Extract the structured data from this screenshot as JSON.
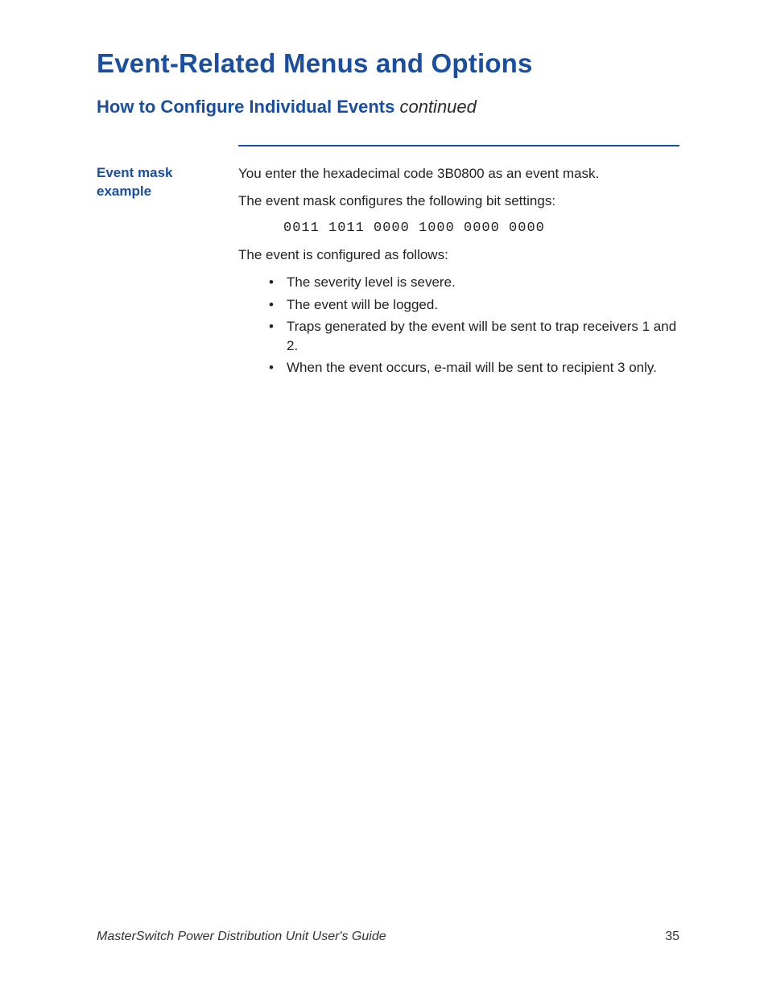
{
  "chapter_title": "Event-Related Menus and Options",
  "section_title": "How to Configure Individual Events",
  "section_suffix": " continued",
  "margin_label_line1": "Event mask",
  "margin_label_line2": "example",
  "body": {
    "p1": "You enter the hexadecimal code 3B0800 as an event mask.",
    "p2": "The event mask configures the following bit settings:",
    "bits": "0011 1011 0000 1000 0000 0000",
    "p3": "The event is configured as follows:",
    "bullets": [
      "The severity level is severe.",
      "The event will be logged.",
      "Traps generated by the event will be sent to trap receivers 1 and 2.",
      "When the event occurs, e-mail will be sent to recipient 3 only."
    ]
  },
  "footer_title": "MasterSwitch Power Distribution Unit User's Guide",
  "page_number": "35"
}
